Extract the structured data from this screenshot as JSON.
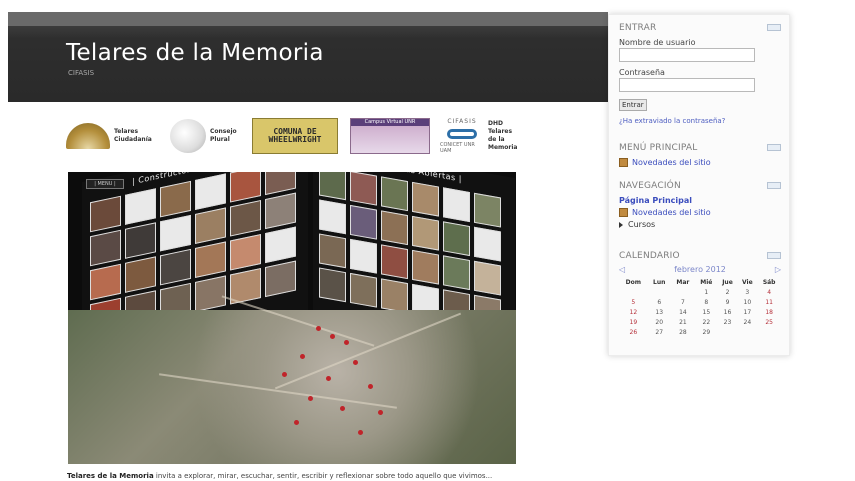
{
  "site": {
    "title": "Telares de la Memoria",
    "subtitle": "CIFASIS"
  },
  "logos": [
    {
      "name": "telares-ciudadania-logo",
      "text": "Telares Ciudadanía"
    },
    {
      "name": "consejo-plural-logo",
      "text": "Consejo Plural"
    },
    {
      "name": "comuna-wheelwright-logo",
      "text": "COMUNA DE WHEELWRIGHT"
    },
    {
      "name": "campus-virtual-logo",
      "text": "Campus Virtual UNR"
    },
    {
      "name": "cifasis-logo",
      "text": "CIFASIS",
      "subtext": "CONICET  UNR  UAM",
      "side_text": "DHD Telares de la Memoria"
    }
  ],
  "hero": {
    "menu_label": "| MENU |",
    "left_wall_title": "| Constructores de Civitas",
    "right_wall_title": "| Obras Abiertas |"
  },
  "intro": {
    "bold": "Telares de la Memoria",
    "text": " invita a explorar, mirar, escuchar, sentir, escribir y reflexionar sobre todo aquello que vivimos..."
  },
  "login": {
    "title": "ENTRAR",
    "username_label": "Nombre de usuario",
    "password_label": "Contraseña",
    "submit_label": "Entrar",
    "forgot_link": "¿Ha extraviado la contraseña?"
  },
  "main_menu": {
    "title": "MENÚ PRINCIPAL",
    "items": [
      "Novedades del sitio"
    ]
  },
  "navigation": {
    "title": "NAVEGACIÓN",
    "home": "Página Principal",
    "news": "Novedades del sitio",
    "courses": "Cursos"
  },
  "calendar": {
    "title": "CALENDARIO",
    "month": "febrero 2012",
    "prev": "◁",
    "next": "▷",
    "weekdays": [
      "Dom",
      "Lun",
      "Mar",
      "Mié",
      "Jue",
      "Vie",
      "Sáb"
    ],
    "weeks": [
      [
        "",
        "",
        "",
        "1",
        "2",
        "3",
        "4"
      ],
      [
        "5",
        "6",
        "7",
        "8",
        "9",
        "10",
        "11"
      ],
      [
        "12",
        "13",
        "14",
        "15",
        "16",
        "17",
        "18"
      ],
      [
        "19",
        "20",
        "21",
        "22",
        "23",
        "24",
        "25"
      ],
      [
        "26",
        "27",
        "28",
        "29",
        "",
        "",
        ""
      ]
    ]
  },
  "colors": {
    "header_dark": "#2a2a2a",
    "link_blue": "#3b4dbd",
    "weekend_red": "#b5303a",
    "map_pin_red": "#c0242a"
  }
}
